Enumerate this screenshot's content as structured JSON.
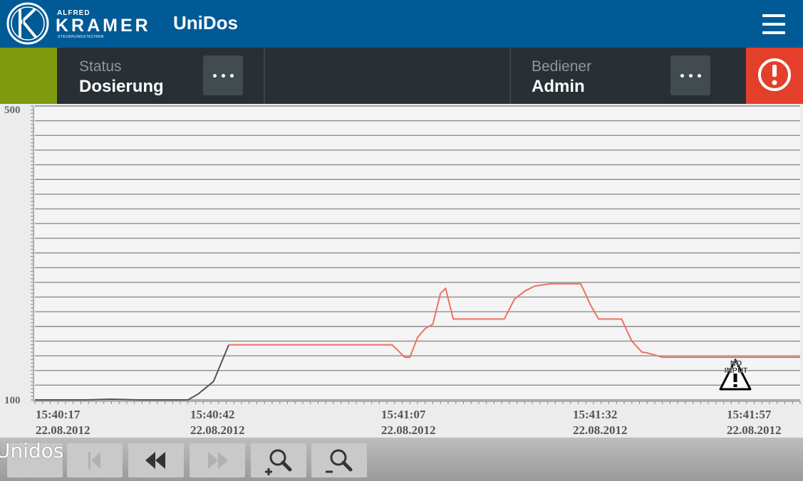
{
  "brand": {
    "small": "ALFRED",
    "main": "KRAMER",
    "sub": "STEUERUNGSTECHNIK",
    "color": "#005a96"
  },
  "app_title": "UniDos",
  "header": {
    "menu_icon": "hamburger-menu-icon"
  },
  "statusbar": {
    "indicator_color": "#7f9a0e",
    "status": {
      "label": "Status",
      "value": "Dosierung"
    },
    "operator": {
      "label": "Bediener",
      "value": "Admin"
    },
    "more_icon": "ellipsis-icon",
    "alarm": {
      "icon": "alert-circle-icon",
      "color": "#e33f2b"
    }
  },
  "chart_data": {
    "type": "line",
    "ylim": [
      100,
      500
    ],
    "y_ticks": [
      "500",
      "100"
    ],
    "x_ticks": [
      {
        "time": "15:40:17",
        "date": "22.08.2012"
      },
      {
        "time": "15:40:42",
        "date": "22.08.2012"
      },
      {
        "time": "15:41:07",
        "date": "22.08.2012"
      },
      {
        "time": "15:41:32",
        "date": "22.08.2012"
      },
      {
        "time": "15:41:57",
        "date": "22.08.2012"
      }
    ],
    "xlim_seconds": [
      0,
      100
    ],
    "grid": true,
    "series": [
      {
        "color": "#555555",
        "points": [
          [
            0,
            100
          ],
          [
            5,
            100
          ],
          [
            10,
            100
          ],
          [
            15,
            101
          ],
          [
            20,
            100
          ],
          [
            25,
            100
          ],
          [
            30,
            100
          ],
          [
            32,
            108
          ],
          [
            35,
            125
          ],
          [
            38,
            175
          ]
        ]
      },
      {
        "color": "#f07060",
        "points": [
          [
            38,
            175
          ],
          [
            48,
            175
          ],
          [
            58,
            175
          ],
          [
            67,
            175
          ],
          [
            70,
            175
          ],
          [
            71.5,
            165
          ],
          [
            72.5,
            158
          ],
          [
            73.5,
            158
          ],
          [
            75,
            185
          ],
          [
            76.5,
            197
          ],
          [
            78,
            203
          ],
          [
            79.5,
            245
          ],
          [
            80.5,
            252
          ],
          [
            82,
            210
          ],
          [
            86,
            210
          ],
          [
            89,
            210
          ],
          [
            92,
            210
          ],
          [
            94,
            237
          ],
          [
            96,
            248
          ],
          [
            98,
            255
          ],
          [
            101,
            258
          ],
          [
            104,
            258
          ],
          [
            107,
            258
          ],
          [
            109,
            228
          ],
          [
            110.5,
            210
          ],
          [
            113,
            210
          ],
          [
            115,
            210
          ],
          [
            117,
            180
          ],
          [
            119,
            165
          ],
          [
            120,
            164
          ],
          [
            123,
            158
          ],
          [
            128,
            158
          ],
          [
            135,
            158
          ],
          [
            142,
            158
          ],
          [
            148,
            158
          ],
          [
            150,
            158
          ]
        ]
      }
    ],
    "no_input_warning": "NO INPUT"
  },
  "toolbar": {
    "first_icon": "skip-to-start-icon",
    "rewind_icon": "rewind-icon",
    "forward_icon": "fast-forward-icon",
    "zoom_in_icon": "zoom-in-icon",
    "zoom_out_icon": "zoom-out-icon"
  },
  "footer_label": "Unidos"
}
